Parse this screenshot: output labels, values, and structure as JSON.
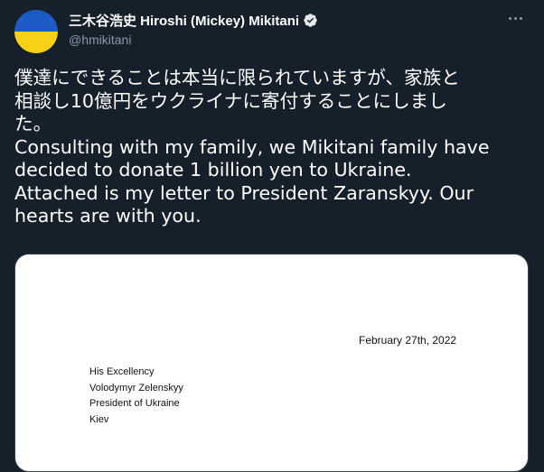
{
  "tweet": {
    "author": {
      "display_name": "三木谷浩史 Hiroshi (Mickey) Mikitani",
      "handle": "@hmikitani",
      "verified": true,
      "avatar": "ukraine-flag-avatar"
    },
    "more_icon": "more-horizontal-icon",
    "text_lines": [
      "僕達にできることは本当に限られていますが、家族と",
      "相談し10億円をウクライナに寄付することにしまし",
      "た。",
      "Consulting with my family, we Mikitani family have",
      "decided to donate 1 billion yen to Ukraine.",
      "Attached is my letter to President Zaranskyy.  Our",
      "hearts are with you."
    ],
    "letter": {
      "date": "February  27th,  2022",
      "address_lines": [
        "His Excellency",
        "Volodymyr Zelenskyy",
        "President of Ukraine",
        "Kiev"
      ]
    }
  },
  "colors": {
    "background": "#15202b",
    "text": "#ffffff",
    "secondary_text": "#8b98a5",
    "verified_badge": "#e7e9ea",
    "flag_blue": "#1d5bc4",
    "flag_yellow": "#f7d117"
  }
}
